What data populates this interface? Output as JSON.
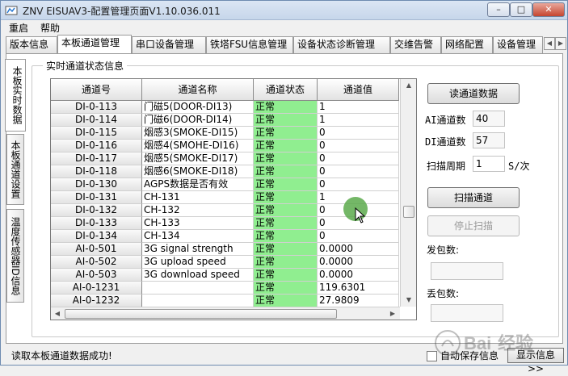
{
  "window": {
    "title": "ZNV EISUAV3-配置管理页面V1.10.036.011",
    "min_label": "–",
    "max_label": "□",
    "close_label": "✕"
  },
  "menu": {
    "items": [
      "重启",
      "帮助"
    ]
  },
  "tabs": [
    "版本信息",
    "本板通道管理",
    "串口设备管理",
    "铁塔FSU信息管理",
    "设备状态诊断管理",
    "交维告警",
    "网络配置",
    "设备管理"
  ],
  "active_tab": "本板通道管理",
  "side_tabs": [
    "本板实时数据",
    "本板通道设置",
    "温度传感器ID信息"
  ],
  "groupbox": {
    "label": "实时通道状态信息"
  },
  "table": {
    "headers": [
      "通道号",
      "通道名称",
      "通道状态",
      "通道值"
    ],
    "rows": [
      [
        "DI-0-113",
        "门磁5(DOOR-DI13)",
        "正常",
        "1"
      ],
      [
        "DI-0-114",
        "门磁6(DOOR-DI14)",
        "正常",
        "1"
      ],
      [
        "DI-0-115",
        "烟感3(SMOKE-DI15)",
        "正常",
        "0"
      ],
      [
        "DI-0-116",
        "烟感4(SMOHE-DI16)",
        "正常",
        "0"
      ],
      [
        "DI-0-117",
        "烟感5(SMOKE-DI17)",
        "正常",
        "0"
      ],
      [
        "DI-0-118",
        "烟感6(SMOKE-DI18)",
        "正常",
        "0"
      ],
      [
        "DI-0-130",
        "AGPS数据是否有效",
        "正常",
        "0"
      ],
      [
        "DI-0-131",
        "CH-131",
        "正常",
        "1"
      ],
      [
        "DI-0-132",
        "CH-132",
        "正常",
        "0"
      ],
      [
        "DI-0-133",
        "CH-133",
        "正常",
        "0"
      ],
      [
        "DI-0-134",
        "CH-134",
        "正常",
        "0"
      ],
      [
        "AI-0-501",
        "3G signal strength",
        "正常",
        "0.0000"
      ],
      [
        "AI-0-502",
        "3G upload speed",
        "正常",
        "0.0000"
      ],
      [
        "AI-0-503",
        "3G download speed",
        "正常",
        "0.0000"
      ],
      [
        "AI-0-1231",
        "",
        "正常",
        "119.6301"
      ],
      [
        "AI-0-1232",
        "",
        "正常",
        "27.9809"
      ]
    ]
  },
  "right_panel": {
    "read_button": "读通道数据",
    "ai_label": "AI通道数",
    "ai_value": "40",
    "di_label": "DI通道数",
    "di_value": "57",
    "scan_period_label": "扫描周期",
    "scan_period_value": "1",
    "scan_period_unit": "S/次",
    "scan_button": "扫描通道",
    "stop_button": "停止扫描",
    "sent_label": "发包数:",
    "sent_value": "",
    "lost_label": "丢包数:",
    "lost_value": ""
  },
  "status": {
    "message": "读取本板通道数据成功!",
    "auto_save_label": "自动保存信息",
    "show_info_button": "显示信息>>"
  },
  "colors": {
    "ok_status": "#90ee90",
    "accent_cursor": "#5caa4c"
  }
}
